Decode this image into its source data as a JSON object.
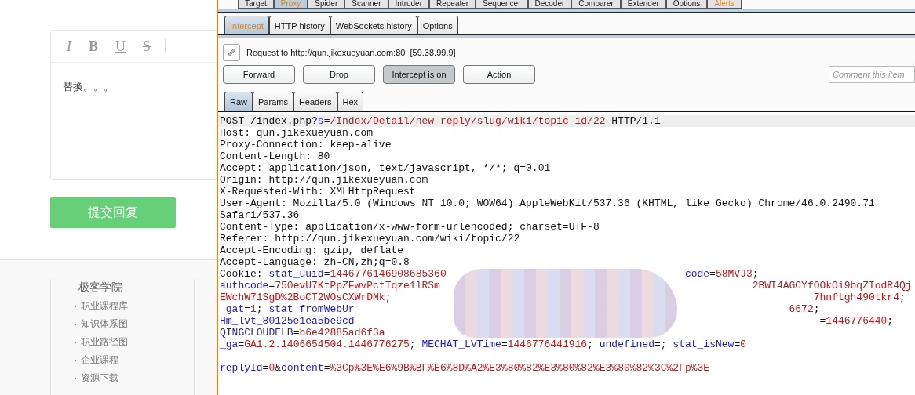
{
  "editor": {
    "toolbar": [
      {
        "label": "I",
        "kind": "italic"
      },
      {
        "label": "B",
        "kind": "bold"
      },
      {
        "label": "U",
        "kind": "underline"
      },
      {
        "label": "S",
        "kind": "strike"
      }
    ],
    "text": "替换。。。"
  },
  "submit_button": "提交回复",
  "footer": {
    "heading": "极客学院",
    "links": [
      "职业课程库",
      "知识体系图",
      "职业路径图",
      "企业课程",
      "资源下载"
    ]
  },
  "burp": {
    "tools": [
      {
        "label": "Target",
        "selected": false,
        "alert": false
      },
      {
        "label": "Proxy",
        "selected": true,
        "alert": false
      },
      {
        "label": "Spider",
        "selected": false,
        "alert": false
      },
      {
        "label": "Scanner",
        "selected": false,
        "alert": false
      },
      {
        "label": "Intruder",
        "selected": false,
        "alert": false
      },
      {
        "label": "Repeater",
        "selected": false,
        "alert": false
      },
      {
        "label": "Sequencer",
        "selected": false,
        "alert": false
      },
      {
        "label": "Decoder",
        "selected": false,
        "alert": false
      },
      {
        "label": "Comparer",
        "selected": false,
        "alert": false
      },
      {
        "label": "Extender",
        "selected": false,
        "alert": false
      },
      {
        "label": "Options",
        "selected": false,
        "alert": false
      },
      {
        "label": "Alerts",
        "selected": false,
        "alert": true
      }
    ],
    "proxy_tabs": [
      {
        "label": "Intercept",
        "selected": true
      },
      {
        "label": "HTTP history",
        "selected": false
      },
      {
        "label": "WebSockets history",
        "selected": false
      },
      {
        "label": "Options",
        "selected": false
      }
    ],
    "request_info": "Request to http://qun.jikexueyuan.com:80  [59.38.99.9]",
    "buttons": [
      {
        "label": "Forward",
        "pressed": false
      },
      {
        "label": "Drop",
        "pressed": false
      },
      {
        "label": "Intercept is on",
        "pressed": true
      },
      {
        "label": "Action",
        "pressed": false
      }
    ],
    "comment": {
      "placeholder": "Comment this item"
    },
    "message_tabs": [
      {
        "label": "Raw",
        "selected": true
      },
      {
        "label": "Params",
        "selected": false
      },
      {
        "label": "Headers",
        "selected": false
      },
      {
        "label": "Hex",
        "selected": false
      }
    ],
    "lines": [
      {
        "current": true,
        "left": [
          {
            "text": "POST /index.php?",
            "kind": "plain"
          },
          {
            "text": "s",
            "kind": "name"
          },
          {
            "text": "=",
            "kind": "plain"
          },
          {
            "text": "/Index/Detail/new_reply/slug/wiki/topic_id/22",
            "kind": "value"
          },
          {
            "text": " HTTP/1.1",
            "kind": "plain"
          }
        ]
      },
      {
        "current": false,
        "left": [
          {
            "text": "Host: qun.jikexueyuan.com",
            "kind": "plain"
          }
        ]
      },
      {
        "current": false,
        "left": [
          {
            "text": "Proxy-Connection: keep-alive",
            "kind": "plain"
          }
        ]
      },
      {
        "current": false,
        "left": [
          {
            "text": "Content-Length: 80",
            "kind": "plain"
          }
        ]
      },
      {
        "current": false,
        "left": [
          {
            "text": "Accept: application/json, text/javascript, */*; q=0.01",
            "kind": "plain"
          }
        ]
      },
      {
        "current": false,
        "left": [
          {
            "text": "Origin: http://qun.jikexueyuan.com",
            "kind": "plain"
          }
        ]
      },
      {
        "current": false,
        "left": [
          {
            "text": "X-Requested-With: XMLHttpRequest",
            "kind": "plain"
          }
        ]
      },
      {
        "current": false,
        "left": [
          {
            "text": "User-Agent: Mozilla/5.0 (Windows NT 10.0; WOW64) AppleWebKit/537.36 (KHTML, like Gecko) Chrome/46.0.2490.71",
            "kind": "plain"
          }
        ]
      },
      {
        "current": false,
        "left": [
          {
            "text": "Safari/537.36",
            "kind": "plain"
          }
        ]
      },
      {
        "current": false,
        "left": [
          {
            "text": "Content-Type: application/x-www-form-urlencoded; charset=UTF-8",
            "kind": "plain"
          }
        ]
      },
      {
        "current": false,
        "left": [
          {
            "text": "Referer: http://qun.jikexueyuan.com/wiki/topic/22",
            "kind": "plain"
          }
        ]
      },
      {
        "current": false,
        "left": [
          {
            "text": "Accept-Encoding: gzip, deflate",
            "kind": "plain"
          }
        ]
      },
      {
        "current": false,
        "left": [
          {
            "text": "Accept-Language: zh-CN,zh;q=0.8",
            "kind": "plain"
          }
        ]
      },
      {
        "current": false,
        "left": [
          {
            "text": "Cookie: ",
            "kind": "plain"
          },
          {
            "text": "stat_uuid",
            "kind": "name"
          },
          {
            "text": "=",
            "kind": "plain"
          },
          {
            "text": "1446776146908685360",
            "kind": "value"
          }
        ],
        "right": [
          {
            "text": "code",
            "kind": "name"
          },
          {
            "text": "=",
            "kind": "plain"
          },
          {
            "text": "58MVJ3",
            "kind": "value"
          },
          {
            "text": ";",
            "kind": "plain"
          }
        ]
      },
      {
        "current": false,
        "left": [
          {
            "text": "authcode",
            "kind": "name"
          },
          {
            "text": "=",
            "kind": "plain"
          },
          {
            "text": "750evU7KtPpZFwvPctTqze1lRSm",
            "kind": "value"
          }
        ],
        "right": [
          {
            "text": "2BWI4AGCYfOOkOi9bqZIodR4Qj",
            "kind": "value"
          }
        ]
      },
      {
        "current": false,
        "left": [
          {
            "text": "EWchW71SgD%2BoCT2WOsCXWrDMk",
            "kind": "value"
          },
          {
            "text": ";",
            "kind": "plain"
          }
        ],
        "right": [
          {
            "text": "7hnftgh490tkr4",
            "kind": "value"
          },
          {
            "text": ";",
            "kind": "plain"
          }
        ]
      },
      {
        "current": false,
        "left": [
          {
            "text": "_gat",
            "kind": "name"
          },
          {
            "text": "=",
            "kind": "plain"
          },
          {
            "text": "1",
            "kind": "value"
          },
          {
            "text": "; ",
            "kind": "plain"
          },
          {
            "text": "stat_fromWebUr",
            "kind": "name"
          }
        ],
        "right": [
          {
            "text": "6672",
            "kind": "value"
          },
          {
            "text": ";",
            "kind": "plain"
          }
        ]
      },
      {
        "current": false,
        "left": [
          {
            "text": "Hm_lvt_80125e1ea5be9cd",
            "kind": "name"
          }
        ],
        "right": [
          {
            "text": "=",
            "kind": "plain"
          },
          {
            "text": "1446776440",
            "kind": "value"
          },
          {
            "text": ";",
            "kind": "plain"
          }
        ]
      },
      {
        "current": false,
        "left": [
          {
            "text": "QINGCLOUDELB",
            "kind": "name"
          },
          {
            "text": "=",
            "kind": "plain"
          },
          {
            "text": "b6e42885ad6f3a",
            "kind": "value"
          }
        ]
      },
      {
        "current": false,
        "left": [
          {
            "text": "_ga",
            "kind": "name"
          },
          {
            "text": "=",
            "kind": "plain"
          },
          {
            "text": "GA1.2.1406654504.1446776275",
            "kind": "value"
          },
          {
            "text": "; ",
            "kind": "plain"
          },
          {
            "text": "MECHAT_LVTime",
            "kind": "name"
          },
          {
            "text": "=",
            "kind": "plain"
          },
          {
            "text": "1446776441916",
            "kind": "value"
          },
          {
            "text": "; ",
            "kind": "plain"
          },
          {
            "text": "undefined",
            "kind": "name"
          },
          {
            "text": "=; ",
            "kind": "plain"
          },
          {
            "text": "stat_isNew",
            "kind": "name"
          },
          {
            "text": "=",
            "kind": "plain"
          },
          {
            "text": "0",
            "kind": "value"
          }
        ]
      },
      {
        "current": false
      },
      {
        "current": false,
        "left": [
          {
            "text": "replyId",
            "kind": "name"
          },
          {
            "text": "=",
            "kind": "plain"
          },
          {
            "text": "0",
            "kind": "value"
          },
          {
            "text": "&",
            "kind": "plain"
          },
          {
            "text": "content",
            "kind": "name"
          },
          {
            "text": "=",
            "kind": "plain"
          },
          {
            "text": "%3Cp%3E%E6%9B%BF%E6%8D%A2%E3%80%82%E3%80%82%E3%80%82%3C%2Fp%3E",
            "kind": "value"
          }
        ]
      }
    ]
  }
}
